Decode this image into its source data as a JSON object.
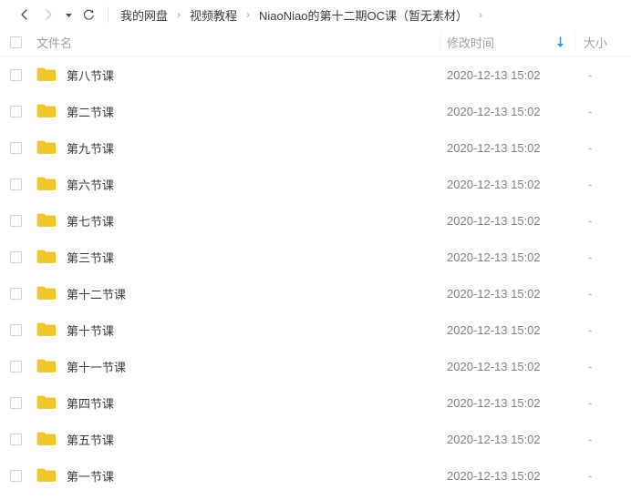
{
  "toolbar": {
    "back_icon": "chevron-left-icon",
    "forward_icon": "chevron-right-icon",
    "dropdown_icon": "triangle-down-icon",
    "refresh_icon": "refresh-icon",
    "breadcrumb": {
      "items": [
        {
          "label": "我的网盘"
        },
        {
          "label": "视频教程"
        },
        {
          "label": "NiaoNiao的第十二期OC课（暂无素材）"
        }
      ],
      "separator": "›",
      "trailing_separator": "›"
    }
  },
  "list": {
    "columns": {
      "name": "文件名",
      "time": "修改时间",
      "size": "大小"
    },
    "sort": {
      "column": "修改时间",
      "direction_icon": "arrow-down-icon",
      "color": "#2b9aee"
    },
    "select_all_checked": false,
    "folder_color": "#f2c52c",
    "rows": [
      {
        "name": "第八节课",
        "time": "2020-12-13 15:02",
        "size": "-",
        "icon": "folder-icon",
        "checked": false
      },
      {
        "name": "第二节课",
        "time": "2020-12-13 15:02",
        "size": "-",
        "icon": "folder-icon",
        "checked": false
      },
      {
        "name": "第九节课",
        "time": "2020-12-13 15:02",
        "size": "-",
        "icon": "folder-icon",
        "checked": false
      },
      {
        "name": "第六节课",
        "time": "2020-12-13 15:02",
        "size": "-",
        "icon": "folder-icon",
        "checked": false
      },
      {
        "name": "第七节课",
        "time": "2020-12-13 15:02",
        "size": "-",
        "icon": "folder-icon",
        "checked": false
      },
      {
        "name": "第三节课",
        "time": "2020-12-13 15:02",
        "size": "-",
        "icon": "folder-icon",
        "checked": false
      },
      {
        "name": "第十二节课",
        "time": "2020-12-13 15:02",
        "size": "-",
        "icon": "folder-icon",
        "checked": false
      },
      {
        "name": "第十节课",
        "time": "2020-12-13 15:02",
        "size": "-",
        "icon": "folder-icon",
        "checked": false
      },
      {
        "name": "第十一节课",
        "time": "2020-12-13 15:02",
        "size": "-",
        "icon": "folder-icon",
        "checked": false
      },
      {
        "name": "第四节课",
        "time": "2020-12-13 15:02",
        "size": "-",
        "icon": "folder-icon",
        "checked": false
      },
      {
        "name": "第五节课",
        "time": "2020-12-13 15:02",
        "size": "-",
        "icon": "folder-icon",
        "checked": false
      },
      {
        "name": "第一节课",
        "time": "2020-12-13 15:02",
        "size": "-",
        "icon": "folder-icon",
        "checked": false
      }
    ]
  }
}
